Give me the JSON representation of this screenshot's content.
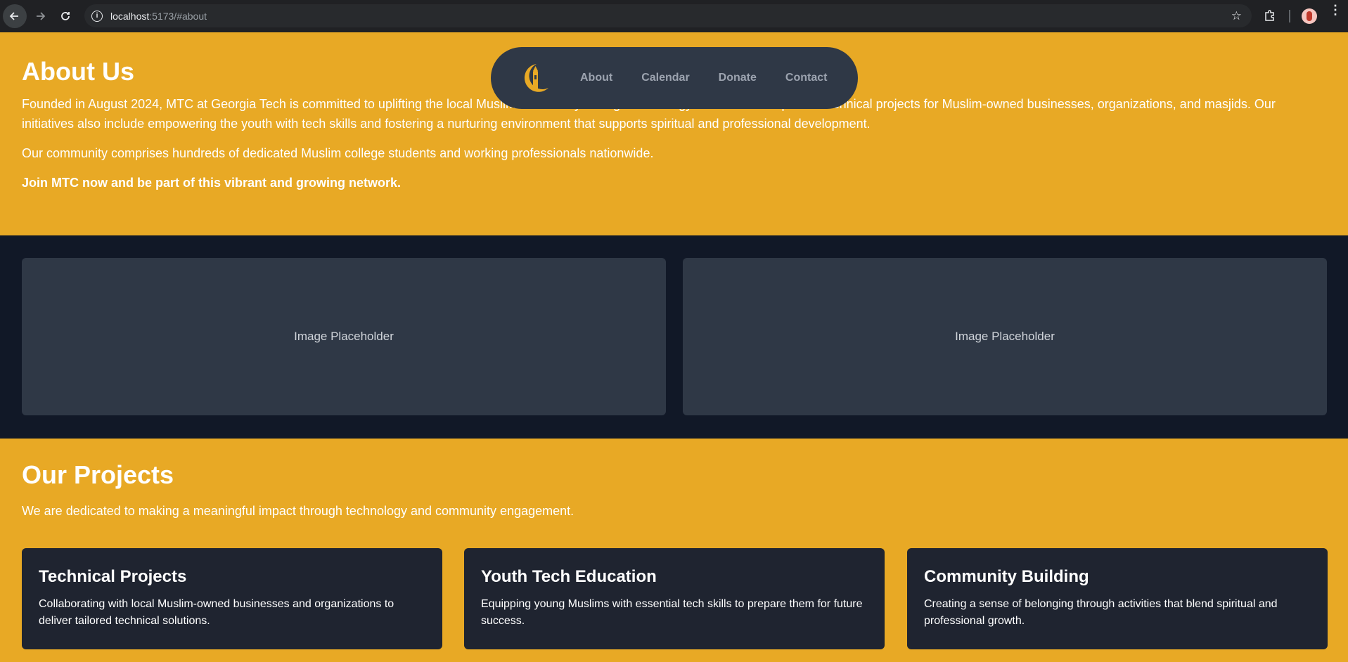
{
  "browser": {
    "url_host": "localhost",
    "url_rest": ":5173/#about"
  },
  "nav": {
    "links": [
      "About",
      "Calendar",
      "Donate",
      "Contact"
    ],
    "logo_color": "#e8a925"
  },
  "about": {
    "title": "About Us",
    "p1": "Founded in August 2024, MTC at Georgia Tech is committed to uplifting the local Muslim community through technology. We execute impactful technical projects for Muslim-owned businesses, organizations, and masjids. Our initiatives also include empowering the youth with tech skills and fostering a nurturing environment that supports spiritual and professional development.",
    "p2": "Our community comprises hundreds of dedicated Muslim college students and working professionals nationwide.",
    "p3": "Join MTC now and be part of this vibrant and growing network."
  },
  "gallery": {
    "left": "Image Placeholder",
    "right": "Image Placeholder"
  },
  "projects": {
    "title": "Our Projects",
    "intro": "We are dedicated to making a meaningful impact through technology and community engagement.",
    "cards": [
      {
        "title": "Technical Projects",
        "text": "Collaborating with local Muslim-owned businesses and organizations to deliver tailored technical solutions."
      },
      {
        "title": "Youth Tech Education",
        "text": "Equipping young Muslims with essential tech skills to prepare them for future success."
      },
      {
        "title": "Community Building",
        "text": "Creating a sense of belonging through activities that blend spiritual and professional growth."
      }
    ]
  },
  "colors": {
    "brand_gold": "#e8a925",
    "dark_bg": "#111827",
    "card_bg": "#1f2430",
    "nav_bg": "#2f3846"
  }
}
